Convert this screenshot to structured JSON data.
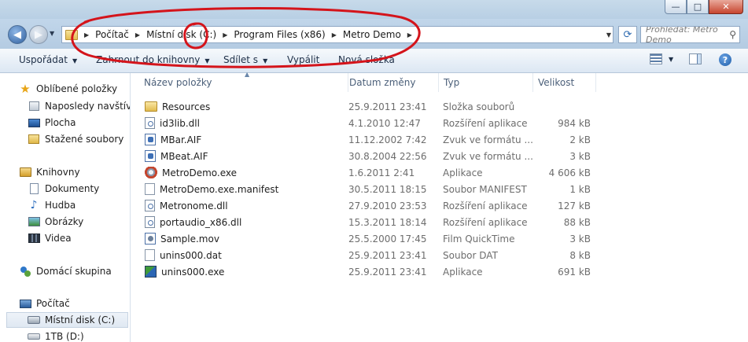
{
  "window": {
    "minimize_label": "—",
    "maximize_label": "□",
    "close_label": "✕"
  },
  "address": {
    "breadcrumb": [
      "Počítač",
      "Místní disk (C:)",
      "Program Files (x86)",
      "Metro Demo"
    ],
    "search_placeholder": "Prohledat: Metro Demo"
  },
  "toolbar": {
    "organize": "Uspořádat",
    "include_library": "Zahrnout do knihovny",
    "share": "Sdílet s",
    "burn": "Vypálit",
    "new_folder": "Nová složka"
  },
  "sidebar": {
    "favorites": "Oblíbené položky",
    "recent": "Naposledy navštívené",
    "desktop": "Plocha",
    "downloads": "Stažené soubory",
    "libraries": "Knihovny",
    "documents": "Dokumenty",
    "music": "Hudba",
    "pictures": "Obrázky",
    "videos": "Videa",
    "homegroup": "Domácí skupina",
    "computer": "Počítač",
    "local_disk": "Místní disk (C:)",
    "drive_d": "1TB (D:)"
  },
  "columns": {
    "name": "Název položky",
    "date": "Datum změny",
    "type": "Typ",
    "size": "Velikost"
  },
  "files": [
    {
      "name": "Resources",
      "date": "25.9.2011 23:41",
      "type": "Složka souborů",
      "size": "",
      "icon": "folder"
    },
    {
      "name": "id3lib.dll",
      "date": "4.1.2010 12:47",
      "type": "Rozšíření aplikace",
      "size": "984 kB",
      "icon": "dll"
    },
    {
      "name": "MBar.AIF",
      "date": "11.12.2002 7:42",
      "type": "Zvuk ve formátu ...",
      "size": "2 kB",
      "icon": "audio"
    },
    {
      "name": "MBeat.AIF",
      "date": "30.8.2004 22:56",
      "type": "Zvuk ve formátu ...",
      "size": "3 kB",
      "icon": "audio"
    },
    {
      "name": "MetroDemo.exe",
      "date": "1.6.2011 2:41",
      "type": "Aplikace",
      "size": "4 606 kB",
      "icon": "exe"
    },
    {
      "name": "MetroDemo.exe.manifest",
      "date": "30.5.2011 18:15",
      "type": "Soubor MANIFEST",
      "size": "1 kB",
      "icon": "file"
    },
    {
      "name": "Metronome.dll",
      "date": "27.9.2010 23:53",
      "type": "Rozšíření aplikace",
      "size": "127 kB",
      "icon": "dll"
    },
    {
      "name": "portaudio_x86.dll",
      "date": "15.3.2011 18:14",
      "type": "Rozšíření aplikace",
      "size": "88 kB",
      "icon": "dll"
    },
    {
      "name": "Sample.mov",
      "date": "25.5.2000 17:45",
      "type": "Film QuickTime",
      "size": "3 kB",
      "icon": "movie"
    },
    {
      "name": "unins000.dat",
      "date": "25.9.2011 23:41",
      "type": "Soubor DAT",
      "size": "8 kB",
      "icon": "file"
    },
    {
      "name": "unins000.exe",
      "date": "25.9.2011 23:41",
      "type": "Aplikace",
      "size": "691 kB",
      "icon": "installer"
    }
  ],
  "annotation_color": "#d4141b"
}
